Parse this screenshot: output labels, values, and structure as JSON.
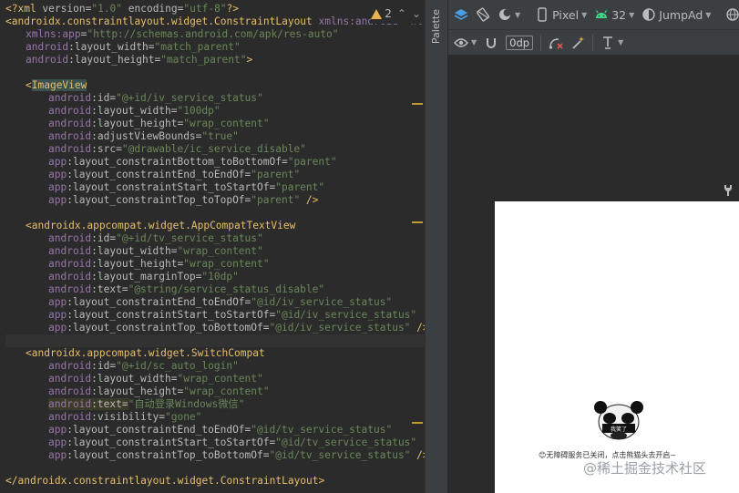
{
  "editor": {
    "warning_count": "2",
    "lines": [
      {
        "indent": 0,
        "parts": [
          [
            "prolog",
            "<?xml "
          ],
          [
            "attr",
            "version"
          ],
          [
            "attr",
            "="
          ],
          [
            "val",
            "\"1.0\""
          ],
          [
            "attr",
            " encoding"
          ],
          [
            "attr",
            "="
          ],
          [
            "val",
            "\"utf-8\""
          ],
          [
            "prolog",
            "?>"
          ]
        ]
      },
      {
        "indent": 0,
        "parts": [
          [
            "tag",
            "<androidx.constraintlayout.widget.ConstraintLayout "
          ],
          [
            "ns",
            "xmlns:android"
          ],
          [
            "attr",
            "="
          ],
          [
            "val",
            "\"http://schemas.android.com/apk/res/android\""
          ]
        ]
      },
      {
        "indent": 1,
        "parts": [
          [
            "ns",
            "xmlns:app"
          ],
          [
            "attr",
            "="
          ],
          [
            "val",
            "\"http://schemas.android.com/apk/res-auto\""
          ]
        ]
      },
      {
        "indent": 1,
        "parts": [
          [
            "ns",
            "android"
          ],
          [
            "attr",
            ":layout_width="
          ],
          [
            "val",
            "\"match_parent\""
          ]
        ]
      },
      {
        "indent": 1,
        "parts": [
          [
            "ns",
            "android"
          ],
          [
            "attr",
            ":layout_height="
          ],
          [
            "val",
            "\"match_parent\""
          ],
          [
            "tag",
            ">"
          ]
        ]
      },
      {
        "indent": 0,
        "parts": []
      },
      {
        "indent": 1,
        "parts": [
          [
            "tag",
            "<"
          ],
          [
            "hltag",
            "ImageView"
          ]
        ]
      },
      {
        "indent": 2,
        "parts": [
          [
            "ns",
            "android"
          ],
          [
            "attr",
            ":id="
          ],
          [
            "val",
            "\"@+id/iv_service_status\""
          ]
        ]
      },
      {
        "indent": 2,
        "parts": [
          [
            "ns",
            "android"
          ],
          [
            "attr",
            ":layout_width="
          ],
          [
            "val",
            "\"100dp\""
          ]
        ]
      },
      {
        "indent": 2,
        "parts": [
          [
            "ns",
            "android"
          ],
          [
            "attr",
            ":layout_height="
          ],
          [
            "val",
            "\"wrap_content\""
          ]
        ]
      },
      {
        "indent": 2,
        "parts": [
          [
            "ns",
            "android"
          ],
          [
            "attr",
            ":adjustViewBounds="
          ],
          [
            "val",
            "\"true\""
          ]
        ]
      },
      {
        "indent": 2,
        "parts": [
          [
            "ns",
            "android"
          ],
          [
            "attr",
            ":src="
          ],
          [
            "val",
            "\"@drawable/ic_service_disable\""
          ]
        ]
      },
      {
        "indent": 2,
        "parts": [
          [
            "ns",
            "app"
          ],
          [
            "attr",
            ":layout_constraintBottom_toBottomOf="
          ],
          [
            "val",
            "\"parent\""
          ]
        ]
      },
      {
        "indent": 2,
        "parts": [
          [
            "ns",
            "app"
          ],
          [
            "attr",
            ":layout_constraintEnd_toEndOf="
          ],
          [
            "val",
            "\"parent\""
          ]
        ]
      },
      {
        "indent": 2,
        "parts": [
          [
            "ns",
            "app"
          ],
          [
            "attr",
            ":layout_constraintStart_toStartOf="
          ],
          [
            "val",
            "\"parent\""
          ]
        ]
      },
      {
        "indent": 2,
        "parts": [
          [
            "ns",
            "app"
          ],
          [
            "attr",
            ":layout_constraintTop_toTopOf="
          ],
          [
            "val",
            "\"parent\""
          ],
          [
            "tag",
            " />"
          ]
        ]
      },
      {
        "indent": 0,
        "parts": []
      },
      {
        "indent": 1,
        "parts": [
          [
            "tag",
            "<androidx.appcompat.widget.AppCompatTextView"
          ]
        ]
      },
      {
        "indent": 2,
        "parts": [
          [
            "ns",
            "android"
          ],
          [
            "attr",
            ":id="
          ],
          [
            "val",
            "\"@+id/tv_service_status\""
          ]
        ]
      },
      {
        "indent": 2,
        "parts": [
          [
            "ns",
            "android"
          ],
          [
            "attr",
            ":layout_width="
          ],
          [
            "val",
            "\"wrap_content\""
          ]
        ]
      },
      {
        "indent": 2,
        "parts": [
          [
            "ns",
            "android"
          ],
          [
            "attr",
            ":layout_height="
          ],
          [
            "val",
            "\"wrap_content\""
          ]
        ]
      },
      {
        "indent": 2,
        "parts": [
          [
            "ns",
            "android"
          ],
          [
            "attr",
            ":layout_marginTop="
          ],
          [
            "val",
            "\"10dp\""
          ]
        ]
      },
      {
        "indent": 2,
        "parts": [
          [
            "ns",
            "android"
          ],
          [
            "attr",
            ":text="
          ],
          [
            "val",
            "\"@string/service_status_disable\""
          ]
        ]
      },
      {
        "indent": 2,
        "parts": [
          [
            "ns",
            "app"
          ],
          [
            "attr",
            ":layout_constraintEnd_toEndOf="
          ],
          [
            "val",
            "\"@id/iv_service_status\""
          ]
        ]
      },
      {
        "indent": 2,
        "parts": [
          [
            "ns",
            "app"
          ],
          [
            "attr",
            ":layout_constraintStart_toStartOf="
          ],
          [
            "val",
            "\"@id/iv_service_status\""
          ]
        ]
      },
      {
        "indent": 2,
        "parts": [
          [
            "ns",
            "app"
          ],
          [
            "attr",
            ":layout_constraintTop_toBottomOf="
          ],
          [
            "val",
            "\"@id/iv_service_status\""
          ],
          [
            "tag",
            " />"
          ]
        ]
      },
      {
        "indent": 0,
        "parts": [],
        "current": true
      },
      {
        "indent": 1,
        "parts": [
          [
            "tag",
            "<androidx.appcompat.widget.SwitchCompat"
          ]
        ]
      },
      {
        "indent": 2,
        "parts": [
          [
            "ns",
            "android"
          ],
          [
            "attr",
            ":id="
          ],
          [
            "val",
            "\"@+id/sc_auto_login\""
          ]
        ]
      },
      {
        "indent": 2,
        "parts": [
          [
            "ns",
            "android"
          ],
          [
            "attr",
            ":layout_width="
          ],
          [
            "val",
            "\"wrap_content\""
          ]
        ]
      },
      {
        "indent": 2,
        "parts": [
          [
            "ns",
            "android"
          ],
          [
            "attr",
            ":layout_height="
          ],
          [
            "val",
            "\"wrap_content\""
          ]
        ]
      },
      {
        "indent": 2,
        "parts": [
          [
            "ns",
            "android"
          ],
          [
            "attr",
            ":text="
          ],
          [
            "val",
            "\"自动登录Windows微信\""
          ]
        ],
        "highlight": true
      },
      {
        "indent": 2,
        "parts": [
          [
            "ns",
            "android"
          ],
          [
            "attr",
            ":visibility="
          ],
          [
            "val",
            "\"gone\""
          ]
        ]
      },
      {
        "indent": 2,
        "parts": [
          [
            "ns",
            "app"
          ],
          [
            "attr",
            ":layout_constraintEnd_toEndOf="
          ],
          [
            "val",
            "\"@id/tv_service_status\""
          ]
        ]
      },
      {
        "indent": 2,
        "parts": [
          [
            "ns",
            "app"
          ],
          [
            "attr",
            ":layout_constraintStart_toStartOf="
          ],
          [
            "val",
            "\"@id/tv_service_status\""
          ]
        ]
      },
      {
        "indent": 2,
        "parts": [
          [
            "ns",
            "app"
          ],
          [
            "attr",
            ":layout_constraintTop_toBottomOf="
          ],
          [
            "val",
            "\"@id/tv_service_status\""
          ],
          [
            "tag",
            " />"
          ]
        ]
      },
      {
        "indent": 0,
        "parts": []
      },
      {
        "indent": 0,
        "parts": [
          [
            "tag",
            "</androidx.constraintlayout.widget.ConstraintLayout>"
          ]
        ]
      }
    ]
  },
  "palette": {
    "label": "Palette"
  },
  "toolbar": {
    "device": "Pixel",
    "api_level": "32",
    "theme": "JumpAd",
    "default_margin": "0dp"
  },
  "preview": {
    "panda_caption": "我笑了",
    "status_text": "😊无障碍服务已关闭，点击熊猫头去开启~"
  },
  "watermark": {
    "text": "@稀土掘金技术社区"
  },
  "colors": {
    "editor_bg": "#2b2b2b",
    "tag": "#e8bf6a",
    "namespace": "#9876aa",
    "value": "#6a8759",
    "warning": "#e6b44a"
  }
}
